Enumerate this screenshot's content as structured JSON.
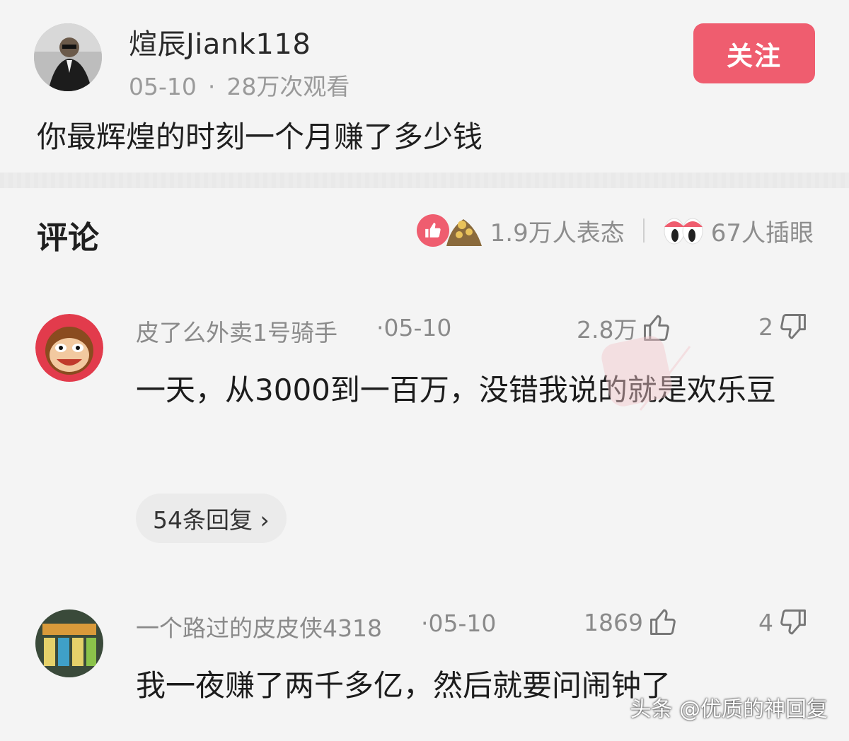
{
  "post": {
    "username": "煊辰Jiank118",
    "date": "05-10",
    "separator": "·",
    "views": "28万次观看",
    "follow_label": "关注",
    "question": "你最辉煌的时刻一个月赚了多少钱"
  },
  "comments_section": {
    "title": "评论",
    "reactions_text": "1.9万人表态",
    "eyes_text": "67人插眼"
  },
  "comments": [
    {
      "user": "皮了么外卖1号骑手",
      "date": "·05-10",
      "likes": "2.8万",
      "dislikes": "2",
      "text": "一天，从3000到一百万，没错我说的就是欢乐豆",
      "replies_label": "54条回复 ›"
    },
    {
      "user": "一个路过的皮皮侠4318",
      "date": "·05-10",
      "likes": "1869",
      "dislikes": "4",
      "text": "我一夜赚了两千多亿，然后就要问闹钟了"
    }
  ],
  "footer_watermark": "头条 @优质的神回复",
  "colors": {
    "accent": "#ef5d6f",
    "meta": "#9a9a9a",
    "background": "#f4f4f4"
  }
}
